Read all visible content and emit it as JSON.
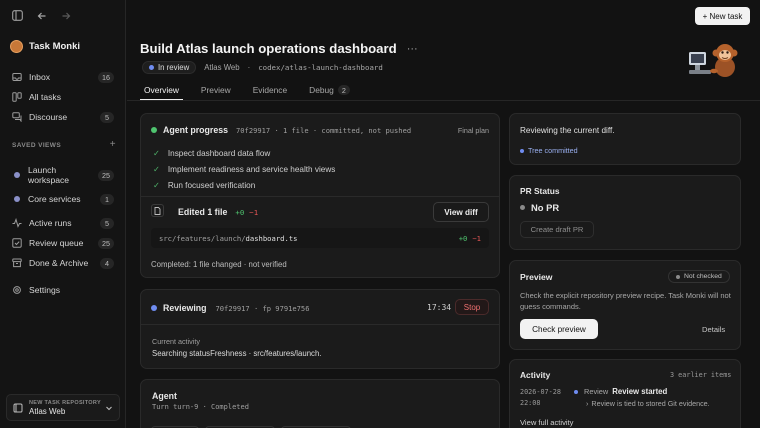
{
  "sidebar": {
    "brand": "Task Monki",
    "nav": [
      {
        "label": "Inbox",
        "count": "16"
      },
      {
        "label": "All tasks",
        "count": ""
      },
      {
        "label": "Discourse",
        "count": "5"
      }
    ],
    "saved_views_label": "SAVED VIEWS",
    "saved_views_add": "+",
    "saved": [
      {
        "label": "Launch workspace",
        "count": "25"
      },
      {
        "label": "Core services",
        "count": "1"
      }
    ],
    "nav2": [
      {
        "label": "Active runs",
        "count": "5"
      },
      {
        "label": "Review queue",
        "count": "25"
      },
      {
        "label": "Done & Archive",
        "count": "4"
      },
      {
        "label": "Settings",
        "count": ""
      }
    ],
    "repo_small": "NEW TASK REPOSITORY",
    "repo_name": "Atlas Web"
  },
  "header": {
    "new_task": "+ New task",
    "title": "Build Atlas launch operations dashboard",
    "more": "···",
    "status": "In review",
    "project": "Atlas Web",
    "separator": "·",
    "branch": "codex/atlas-launch-dashboard",
    "tabs": [
      {
        "label": "Overview",
        "count": ""
      },
      {
        "label": "Preview",
        "count": ""
      },
      {
        "label": "Evidence",
        "count": ""
      },
      {
        "label": "Debug",
        "count": "2"
      }
    ]
  },
  "progress": {
    "title": "Agent progress",
    "meta": "70f29917 · 1 file · committed, not pushed",
    "plan": "Final plan",
    "steps": [
      "Inspect dashboard data flow",
      "Implement readiness and service health views",
      "Run focused verification"
    ],
    "edited": "Edited 1 file",
    "adds": "+0",
    "dels": "−1",
    "view_diff": "View diff",
    "file_dir": "src/features/launch/",
    "file_name": "dashboard.ts",
    "file_adds": "+0",
    "file_dels": "−1",
    "completed": "Completed: 1 file changed · not verified"
  },
  "reviewing": {
    "title": "Reviewing",
    "meta": "70f29917 · fp 9791e756",
    "time": "17:34",
    "stop": "Stop",
    "activity_label": "Current activity",
    "activity": "Searching statusFreshness · src/features/launch."
  },
  "agent": {
    "title": "Agent",
    "meta": "Turn turn-9 · Completed"
  },
  "right": {
    "reviewing_text": "Reviewing the current diff.",
    "tree": "Tree committed",
    "pr_title": "PR Status",
    "pr_value": "No PR",
    "create_pr": "Create draft PR",
    "preview_title": "Preview",
    "not_checked": "Not checked",
    "preview_desc": "Check the explicit repository preview recipe. Task Monki will not guess commands.",
    "check_preview": "Check preview",
    "details": "Details",
    "activity_title": "Activity",
    "earlier": "3 earlier items",
    "date": "2026-07-28",
    "time": "22:08",
    "event_kind": "Review",
    "event_title": "Review started",
    "event_detail": "Review is tied to stored Git evidence.",
    "view_full": "View full activity"
  },
  "colors": {
    "accent": "#6f8cf0",
    "success": "#4fc46f",
    "danger": "#e25555",
    "stop": "#f07070"
  }
}
